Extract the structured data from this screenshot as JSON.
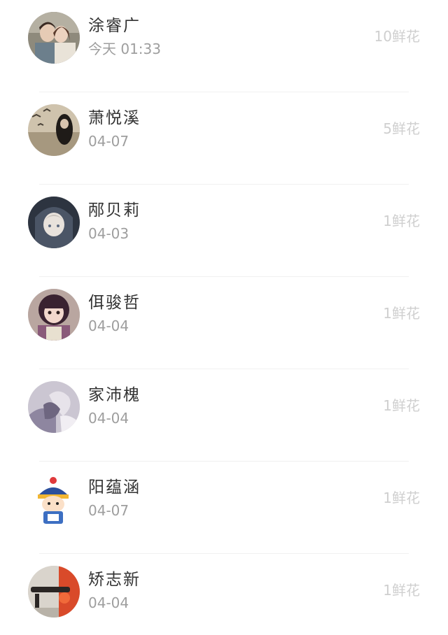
{
  "rows": [
    {
      "name": "涂睿广",
      "time": "今天 01:33",
      "flowers": "10鲜花",
      "avatar": "avatar-couple-photo"
    },
    {
      "name": "萧悦溪",
      "time": "04-07",
      "flowers": "5鲜花",
      "avatar": "avatar-girl-birds-photo"
    },
    {
      "name": "邴贝莉",
      "time": "04-03",
      "flowers": "1鲜花",
      "avatar": "avatar-anime-hood"
    },
    {
      "name": "佴骏哲",
      "time": "04-04",
      "flowers": "1鲜花",
      "avatar": "avatar-doll-girl"
    },
    {
      "name": "家沛槐",
      "time": "04-04",
      "flowers": "1鲜花",
      "avatar": "avatar-hands-heart"
    },
    {
      "name": "阳蕴涵",
      "time": "04-07",
      "flowers": "1鲜花",
      "avatar": "avatar-cartoon-qing-official"
    },
    {
      "name": "矫志新",
      "time": "04-04",
      "flowers": "1鲜花",
      "avatar": "avatar-red-tools"
    }
  ],
  "colors": {
    "name": "#333333",
    "time": "#9e9e9e",
    "flowers": "#cfcfcf",
    "divider": "#f0f0f0"
  }
}
